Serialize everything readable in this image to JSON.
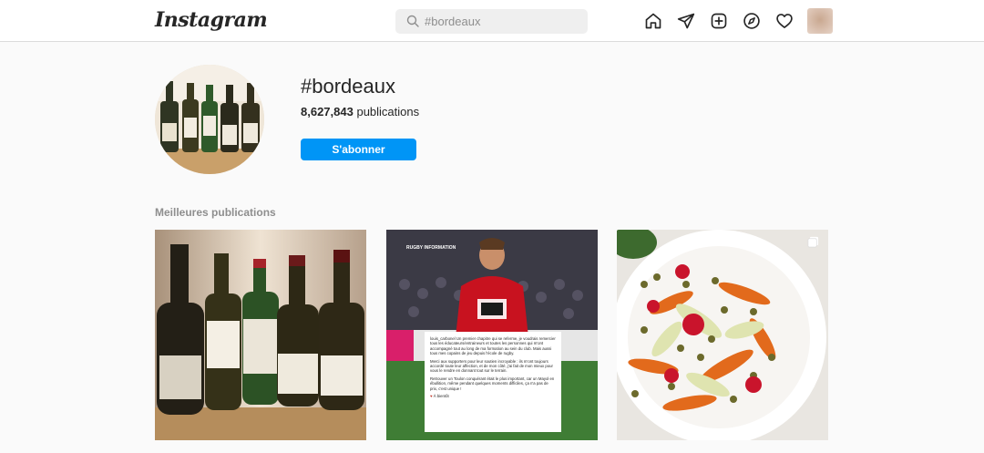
{
  "app": {
    "logo_text": "Instagram"
  },
  "search": {
    "placeholder": "#bordeaux"
  },
  "nav": {
    "icons": [
      "home-icon",
      "direct-icon",
      "new-post-icon",
      "explore-icon",
      "activity-icon"
    ]
  },
  "hashtag": {
    "title": "#bordeaux",
    "post_count": "8,627,843",
    "post_count_suffix": "publications",
    "follow_label": "S'abonner"
  },
  "top_posts": {
    "title": "Meilleures publications",
    "posts": [
      {
        "kind": "image",
        "subject": "wine-bottles"
      },
      {
        "kind": "image",
        "subject": "rugby-player",
        "overlay_tag": "RUGBY INFORMATION",
        "caption_lines": [
          "louis_carbonel Un premier chapitre qui se referme, je voudrais remercier tous les éducateurs/entraineurs et toutes les personnes qui m'ont accompagné tout au long de ma formation au sein du club. Mais aussi tous mes copains de jeu depuis l'école de rugby.",
          "Merci aux supporters pour leur soutien incroyable : ils m'ont toujours accordé toute leur affection, et de mon côté, j'ai fait de mon mieux pour vous le rendre en donnant tout sur le terrain.",
          "Retrouver un Toulon conquérant était le plus important, car un Mayol en ébullition, même pendant quelques moments difficiles, ça n'a pas de prix, c'est unique !",
          "À bientôt"
        ]
      },
      {
        "kind": "image",
        "subject": "lentil-salad",
        "multi": true
      }
    ]
  },
  "colors": {
    "accent": "#0095f6",
    "background": "#fafafa",
    "text": "#262626",
    "muted": "#8e8e8e",
    "border": "#dbdbdb"
  }
}
